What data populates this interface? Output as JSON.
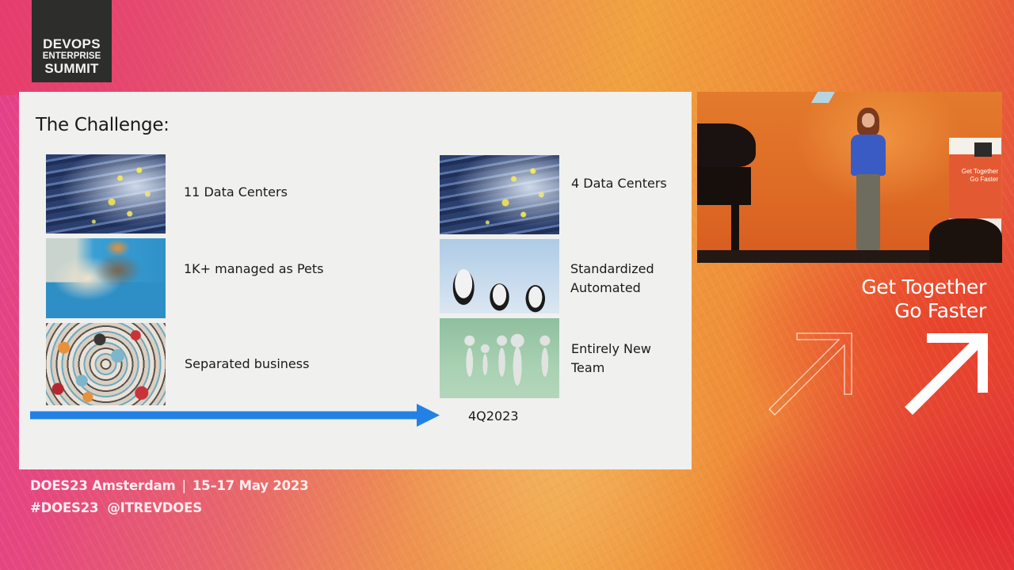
{
  "brand": {
    "logo_lines": [
      "DEVOPS",
      "ENTERPRISE",
      "SUMMIT"
    ]
  },
  "slide": {
    "title": "The Challenge:",
    "before": [
      {
        "image": "server-racks-photo",
        "caption": "11 Data Centers"
      },
      {
        "image": "dog-and-cat-on-couch-photo",
        "caption": "1K+ managed as Pets"
      },
      {
        "image": "colorful-figurines-crowd-photo",
        "caption": "Separated business"
      }
    ],
    "after": [
      {
        "image": "server-racks-photo",
        "caption_lines": [
          "4 Data Centers"
        ]
      },
      {
        "image": "cows-herd-photo",
        "caption_lines": [
          "Standardized",
          "Automated"
        ]
      },
      {
        "image": "paper-people-team-photo",
        "caption_lines": [
          "Entirely New",
          "Team"
        ]
      }
    ],
    "timeline": {
      "arrow_icon": "right-arrow-icon",
      "arrow_color": "#2381e6",
      "end_label": "4Q2023"
    }
  },
  "event": {
    "line1_name": "DOES23 Amsterdam",
    "line1_separator": "|",
    "line1_dates": "15–17 May 2023",
    "line2_hashtag": "#DOES23",
    "line2_handle": "@ITREVDOES"
  },
  "video": {
    "description": "speaker on stage",
    "banner_text_lines": [
      "Get Together",
      "Go Faster"
    ]
  },
  "tagline": {
    "lines": [
      "Get Together",
      "Go Faster"
    ]
  },
  "colors": {
    "slide_background": "#f0f0ef",
    "logo_background": "#2d2d2b",
    "arrow_blue": "#2381e6"
  }
}
